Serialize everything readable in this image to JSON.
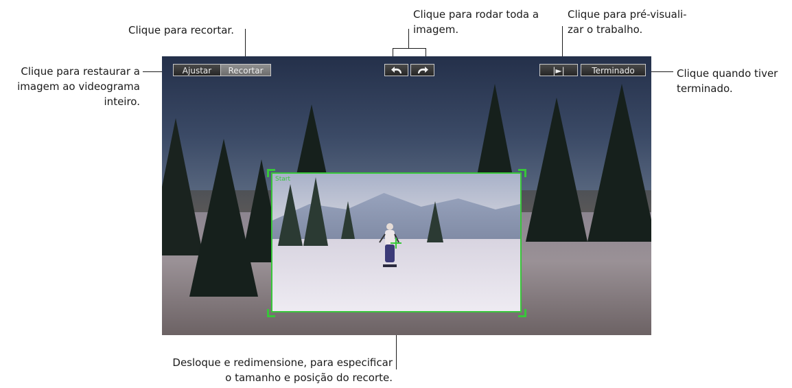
{
  "viewer": {
    "buttons": {
      "fit": "Ajustar",
      "crop": "Recortar",
      "rotate_left_icon": "rotate-left-icon",
      "rotate_right_icon": "rotate-right-icon",
      "play": "|►|",
      "done": "Terminado"
    },
    "crop_label": "Start"
  },
  "callouts": {
    "crop": "Clique para recortar.",
    "fit_line1": "Clique para restaurar a",
    "fit_line2": "imagem ao videograma",
    "fit_line3": "inteiro.",
    "rotate_line1": "Clique para rodar toda a",
    "rotate_line2": "imagem.",
    "preview_line1": "Clique para pré-visuali-",
    "preview_line2": "zar o trabalho.",
    "done_line1": "Clique quando tiver",
    "done_line2": "terminado.",
    "move_line1": "Desloque e redimensione, para especificar",
    "move_line2": "o tamanho e posição do recorte."
  },
  "colors": {
    "crop_border": "#38c63a",
    "text": "#1a1a1a"
  }
}
